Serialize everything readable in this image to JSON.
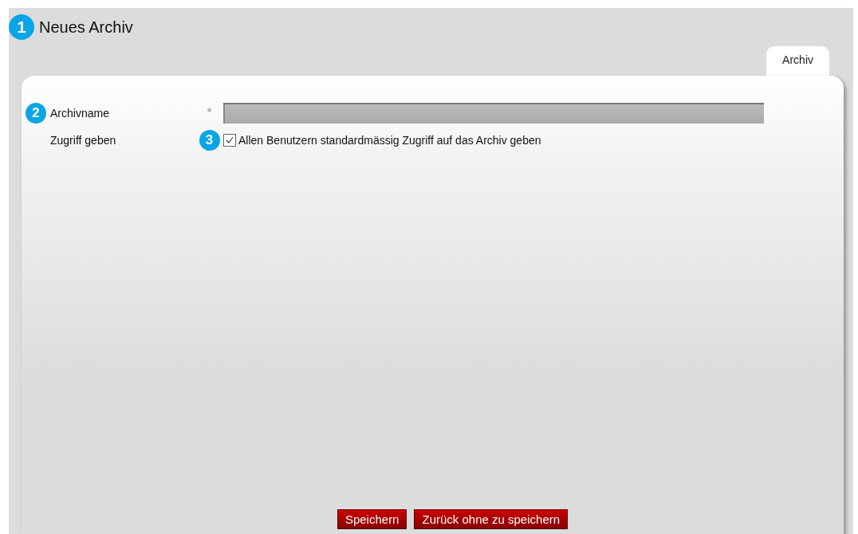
{
  "page": {
    "title": "Neues Archiv",
    "marker": "1"
  },
  "tabs": [
    {
      "label": "Archiv",
      "selected": true
    }
  ],
  "form": {
    "rows": [
      {
        "kind": "text",
        "marker": "2",
        "label": "Archivname",
        "required_mark": "*",
        "value": ""
      },
      {
        "kind": "checkbox",
        "marker": "3",
        "label": "Zugriff geben",
        "option": "Allen Benutzern standardmässig Zugriff auf das Archiv geben",
        "checked": true
      }
    ]
  },
  "buttons": [
    "Speichern",
    "Zurück ohne zu speichern"
  ]
}
